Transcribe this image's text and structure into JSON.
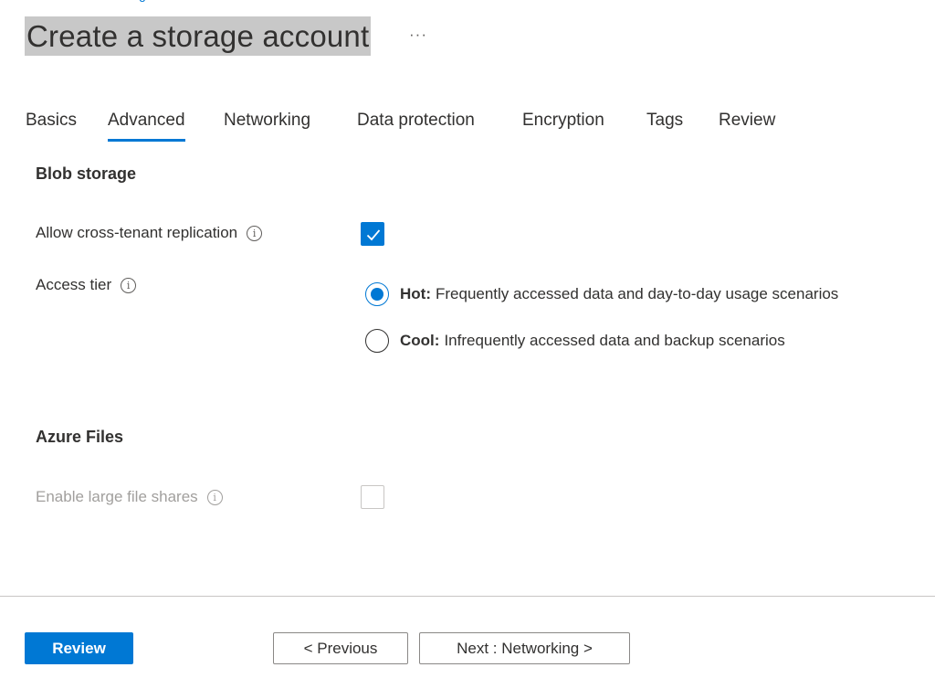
{
  "breadcrumb_fragment": "g",
  "header": {
    "title": "Create a storage account",
    "more_label": "···"
  },
  "tabs": [
    {
      "label": "Basics",
      "active": false
    },
    {
      "label": "Advanced",
      "active": true
    },
    {
      "label": "Networking",
      "active": false
    },
    {
      "label": "Data protection",
      "active": false
    },
    {
      "label": "Encryption",
      "active": false
    },
    {
      "label": "Tags",
      "active": false
    },
    {
      "label": "Review",
      "active": false
    }
  ],
  "blob_storage": {
    "title": "Blob storage",
    "cross_tenant": {
      "label": "Allow cross-tenant replication",
      "checked": true
    },
    "access_tier": {
      "label": "Access tier",
      "options": [
        {
          "name": "Hot:",
          "description": "Frequently accessed data and day-to-day usage scenarios",
          "selected": true
        },
        {
          "name": "Cool:",
          "description": "Infrequently accessed data and backup scenarios",
          "selected": false
        }
      ]
    }
  },
  "azure_files": {
    "title": "Azure Files",
    "large_file_shares": {
      "label": "Enable large file shares",
      "checked": false,
      "disabled": true
    }
  },
  "footer": {
    "review_label": "Review",
    "previous_label": "< Previous",
    "next_label": "Next : Networking >"
  },
  "colors": {
    "accent": "#0078d4",
    "title_highlight": "#c8c8c8",
    "disabled_text": "#a19f9d"
  },
  "icons": {
    "info": "info-icon",
    "check": "checkmark-icon",
    "more": "more-ellipsis-icon"
  }
}
